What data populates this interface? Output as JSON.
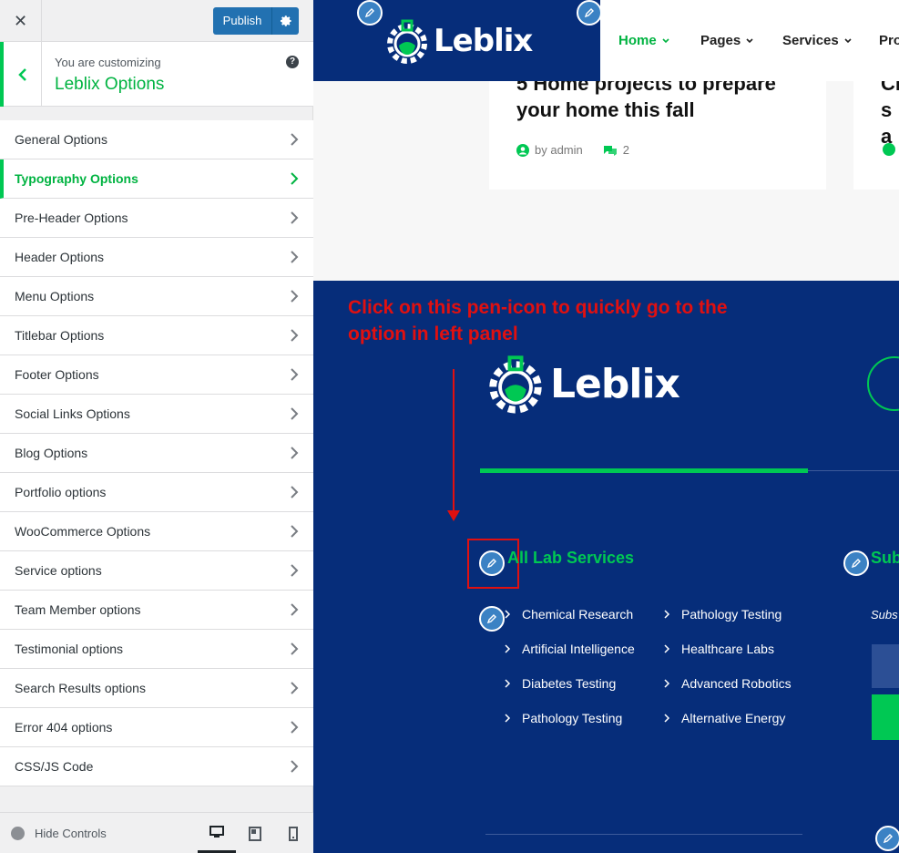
{
  "topbar": {
    "close_glyph": "✕",
    "publish_label": "Publish"
  },
  "info": {
    "customizing_label": "You are customizing",
    "title": "Leblix Options",
    "help_glyph": "?"
  },
  "menu": {
    "items": [
      {
        "label": "General Options",
        "active": false
      },
      {
        "label": "Typography Options",
        "active": true
      },
      {
        "label": "Pre-Header Options",
        "active": false
      },
      {
        "label": "Header Options",
        "active": false
      },
      {
        "label": "Menu Options",
        "active": false
      },
      {
        "label": "Titlebar Options",
        "active": false
      },
      {
        "label": "Footer Options",
        "active": false
      },
      {
        "label": "Social Links Options",
        "active": false
      },
      {
        "label": "Blog Options",
        "active": false
      },
      {
        "label": "Portfolio options",
        "active": false
      },
      {
        "label": "WooCommerce Options",
        "active": false
      },
      {
        "label": "Service options",
        "active": false
      },
      {
        "label": "Team Member options",
        "active": false
      },
      {
        "label": "Testimonial options",
        "active": false
      },
      {
        "label": "Search Results options",
        "active": false
      },
      {
        "label": "Error 404 options",
        "active": false
      },
      {
        "label": "CSS/JS Code",
        "active": false
      }
    ]
  },
  "footerbar": {
    "hide_controls_label": "Hide Controls"
  },
  "preview": {
    "logo_text": "Leblix",
    "nav": [
      "Home",
      "Pages",
      "Services",
      "Pro"
    ],
    "card1": {
      "title": "5 Home projects to prepare your home this fall",
      "author": "by admin",
      "comments": "2"
    },
    "card2": {
      "title": "Cl sa"
    },
    "annotation": "Click on this pen-icon to quickly go to the option in left panel",
    "footer": {
      "lab_title": "All Lab Services",
      "sub_title": "Sub",
      "services_col1": [
        "Chemical Research",
        "Artificial Intelligence",
        "Diabetes Testing",
        "Pathology Testing"
      ],
      "services_col2": [
        "Pathology Testing",
        "Healthcare Labs",
        "Advanced Robotics",
        "Alternative Energy"
      ],
      "subscribe_text": "Subs"
    }
  },
  "colors": {
    "accent_green": "#00c853",
    "wp_blue": "#2271b1",
    "footer_navy": "#062d7a",
    "annotation_red": "#e01010"
  }
}
